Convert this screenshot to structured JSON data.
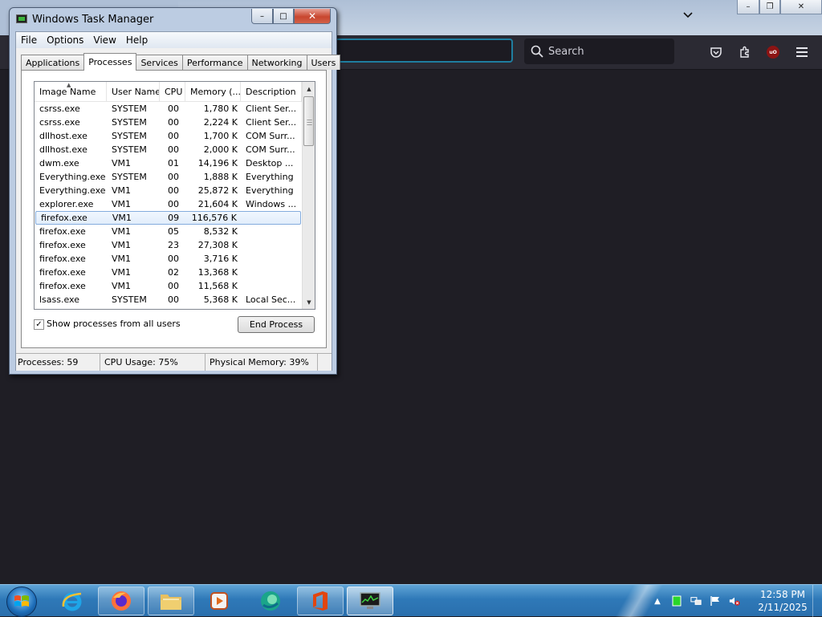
{
  "firefox": {
    "search_placeholder": "Search"
  },
  "taskmanager": {
    "title": "Windows Task Manager",
    "window_controls": {
      "minimize": "–",
      "maximize": "□",
      "close": "✕"
    },
    "menu": [
      "File",
      "Options",
      "View",
      "Help"
    ],
    "tabs": [
      {
        "label": "Applications"
      },
      {
        "label": "Processes",
        "active": true
      },
      {
        "label": "Services"
      },
      {
        "label": "Performance"
      },
      {
        "label": "Networking"
      },
      {
        "label": "Users"
      }
    ],
    "columns": [
      "Image Name",
      "User Name",
      "CPU",
      "Memory (...",
      "Description"
    ],
    "rows": [
      {
        "name": "csrss.exe",
        "user": "SYSTEM",
        "cpu": "00",
        "mem": "1,780 K",
        "desc": "Client Ser..."
      },
      {
        "name": "csrss.exe",
        "user": "SYSTEM",
        "cpu": "00",
        "mem": "2,224 K",
        "desc": "Client Ser..."
      },
      {
        "name": "dllhost.exe",
        "user": "SYSTEM",
        "cpu": "00",
        "mem": "1,700 K",
        "desc": "COM Surr..."
      },
      {
        "name": "dllhost.exe",
        "user": "SYSTEM",
        "cpu": "00",
        "mem": "2,000 K",
        "desc": "COM Surr..."
      },
      {
        "name": "dwm.exe",
        "user": "VM1",
        "cpu": "01",
        "mem": "14,196 K",
        "desc": "Desktop ..."
      },
      {
        "name": "Everything.exe",
        "user": "SYSTEM",
        "cpu": "00",
        "mem": "1,888 K",
        "desc": "Everything"
      },
      {
        "name": "Everything.exe",
        "user": "VM1",
        "cpu": "00",
        "mem": "25,872 K",
        "desc": "Everything"
      },
      {
        "name": "explorer.exe",
        "user": "VM1",
        "cpu": "00",
        "mem": "21,604 K",
        "desc": "Windows ..."
      },
      {
        "name": "firefox.exe",
        "user": "VM1",
        "cpu": "09",
        "mem": "116,576 K",
        "desc": "",
        "selected": true
      },
      {
        "name": "firefox.exe",
        "user": "VM1",
        "cpu": "05",
        "mem": "8,532 K",
        "desc": ""
      },
      {
        "name": "firefox.exe",
        "user": "VM1",
        "cpu": "23",
        "mem": "27,308 K",
        "desc": ""
      },
      {
        "name": "firefox.exe",
        "user": "VM1",
        "cpu": "00",
        "mem": "3,716 K",
        "desc": ""
      },
      {
        "name": "firefox.exe",
        "user": "VM1",
        "cpu": "02",
        "mem": "13,368 K",
        "desc": ""
      },
      {
        "name": "firefox.exe",
        "user": "VM1",
        "cpu": "00",
        "mem": "11,568 K",
        "desc": ""
      },
      {
        "name": "lsass.exe",
        "user": "SYSTEM",
        "cpu": "00",
        "mem": "5,368 K",
        "desc": "Local Sec..."
      }
    ],
    "show_all_checkbox": {
      "label": "Show processes from all users",
      "checked": true
    },
    "end_process_label": "End Process",
    "status": {
      "processes": "Processes: 59",
      "cpu": "CPU Usage: 75%",
      "memory": "Physical Memory: 39%"
    }
  },
  "taskbar": {
    "apps": [
      {
        "name": "internet-explorer",
        "icon": "ie-icon"
      },
      {
        "name": "firefox",
        "icon": "firefox-icon"
      },
      {
        "name": "file-explorer",
        "icon": "folder-icon"
      },
      {
        "name": "media-player",
        "icon": "media-player-icon"
      },
      {
        "name": "edge-app",
        "icon": "edge-icon"
      },
      {
        "name": "office",
        "icon": "office-icon"
      },
      {
        "name": "task-manager",
        "icon": "task-manager-icon"
      }
    ],
    "clock": {
      "time": "12:58 PM",
      "date": "2/11/2025"
    }
  }
}
